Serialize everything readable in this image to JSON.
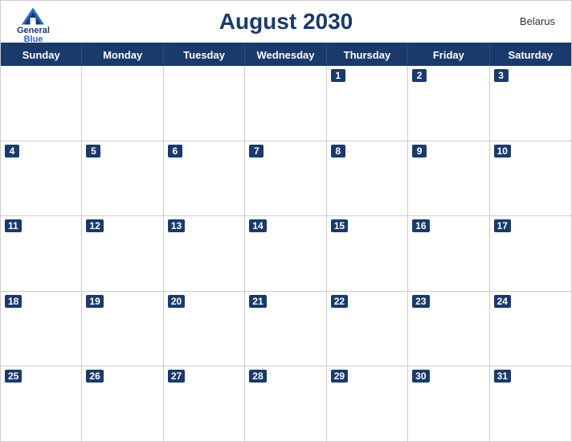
{
  "header": {
    "title": "August 2030",
    "country": "Belarus",
    "logo": {
      "general": "General",
      "blue": "Blue"
    }
  },
  "days_of_week": [
    "Sunday",
    "Monday",
    "Tuesday",
    "Wednesday",
    "Thursday",
    "Friday",
    "Saturday"
  ],
  "weeks": [
    [
      null,
      null,
      null,
      null,
      1,
      2,
      3
    ],
    [
      4,
      5,
      6,
      7,
      8,
      9,
      10
    ],
    [
      11,
      12,
      13,
      14,
      15,
      16,
      17
    ],
    [
      18,
      19,
      20,
      21,
      22,
      23,
      24
    ],
    [
      25,
      26,
      27,
      28,
      29,
      30,
      31
    ]
  ],
  "colors": {
    "header_bg": "#1a3a6b",
    "header_text": "#ffffff",
    "title_color": "#1a3a6b",
    "border": "#cccccc"
  }
}
